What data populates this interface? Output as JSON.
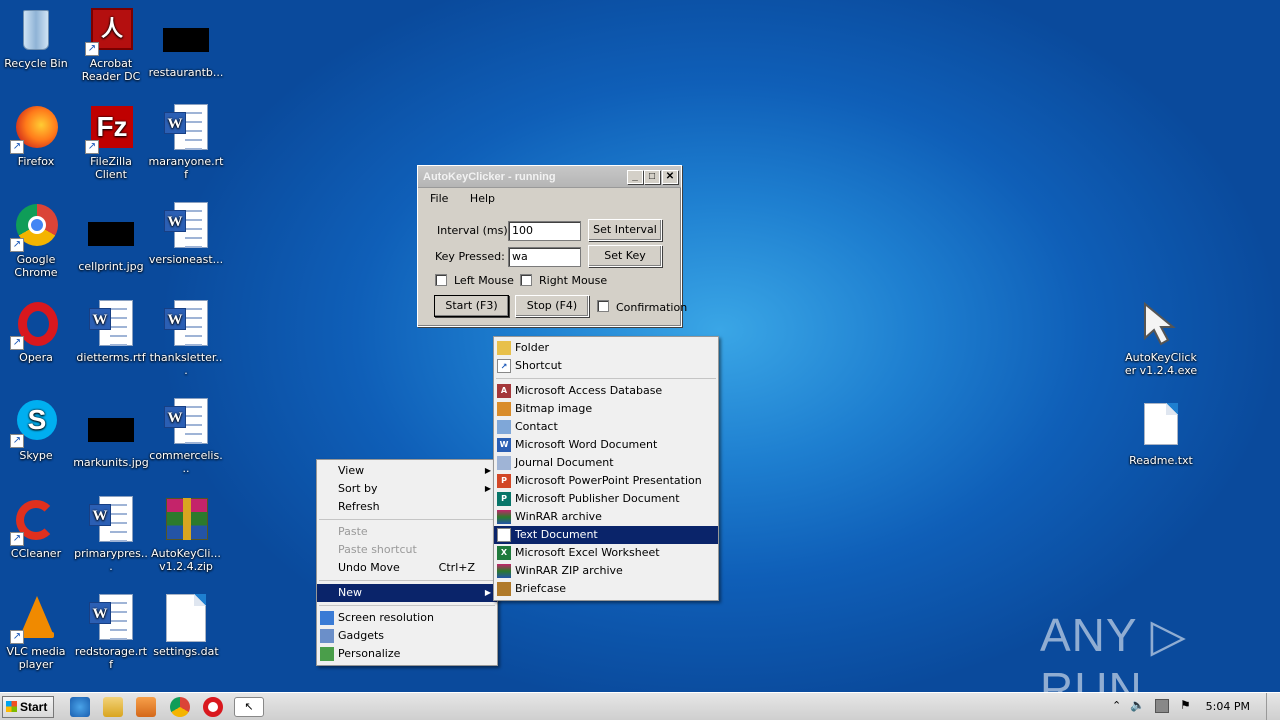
{
  "desktop_icons": [
    {
      "label": "Recycle Bin",
      "icon": "recycle-bin-icon"
    },
    {
      "label": "Acrobat Reader DC",
      "icon": "acrobat-icon"
    },
    {
      "label": "restaurantb...",
      "icon": "image-thumbnail-icon"
    },
    {
      "label": "Firefox",
      "icon": "firefox-icon"
    },
    {
      "label": "FileZilla Client",
      "icon": "filezilla-icon"
    },
    {
      "label": "maranyone.rtf",
      "icon": "word-doc-icon"
    },
    {
      "label": "Google Chrome",
      "icon": "chrome-icon"
    },
    {
      "label": "cellprint.jpg",
      "icon": "image-thumbnail-icon"
    },
    {
      "label": "versioneast...",
      "icon": "word-doc-icon"
    },
    {
      "label": "Opera",
      "icon": "opera-icon"
    },
    {
      "label": "dietterms.rtf",
      "icon": "word-doc-icon"
    },
    {
      "label": "thanksletter...",
      "icon": "word-doc-icon"
    },
    {
      "label": "Skype",
      "icon": "skype-icon"
    },
    {
      "label": "markunits.jpg",
      "icon": "image-thumbnail-icon"
    },
    {
      "label": "commercelis...",
      "icon": "word-doc-icon"
    },
    {
      "label": "CCleaner",
      "icon": "ccleaner-icon"
    },
    {
      "label": "primarypres...",
      "icon": "word-doc-icon"
    },
    {
      "label": "AutoKeyCli... v1.2.4.zip",
      "icon": "winrar-icon"
    },
    {
      "label": "VLC media player",
      "icon": "vlc-icon"
    },
    {
      "label": "redstorage.rtf",
      "icon": "word-doc-icon"
    },
    {
      "label": "settings.dat",
      "icon": "file-icon"
    },
    {
      "label": "AutoKeyClicker v1.2.4.exe",
      "icon": "cursor-arrow-icon"
    },
    {
      "label": "Readme.txt",
      "icon": "text-file-icon"
    }
  ],
  "dialog": {
    "title": "AutoKeyClicker - running",
    "menu": [
      "File",
      "Help"
    ],
    "interval_label": "Interval (ms):",
    "interval_value": "100",
    "set_interval": "Set Interval",
    "key_label": "Key Pressed:",
    "key_value": "wa",
    "set_key": "Set Key",
    "left_mouse": "Left Mouse",
    "right_mouse": "Right Mouse",
    "start": "Start (F3)",
    "stop": "Stop (F4)",
    "confirmation": "Confirmation"
  },
  "context_menu": {
    "view": "View",
    "sort_by": "Sort by",
    "refresh": "Refresh",
    "paste": "Paste",
    "paste_shortcut": "Paste shortcut",
    "undo_move": "Undo Move",
    "undo_shortcut": "Ctrl+Z",
    "new": "New",
    "screen_resolution": "Screen resolution",
    "gadgets": "Gadgets",
    "personalize": "Personalize"
  },
  "new_submenu": {
    "items_top": [
      "Folder",
      "Shortcut"
    ],
    "items": [
      "Microsoft Access Database",
      "Bitmap image",
      "Contact",
      "Microsoft Word Document",
      "Journal Document",
      "Microsoft PowerPoint Presentation",
      "Microsoft Publisher Document",
      "WinRAR archive",
      "Text Document",
      "Microsoft Excel Worksheet",
      "WinRAR ZIP archive",
      "Briefcase"
    ],
    "selected": "Text Document"
  },
  "taskbar": {
    "start": "Start",
    "clock": "5:04 PM"
  },
  "watermark": "ANY ▷ RUN",
  "colors": {
    "selection": "#0a246a",
    "desktop": "#1e7fd0"
  }
}
